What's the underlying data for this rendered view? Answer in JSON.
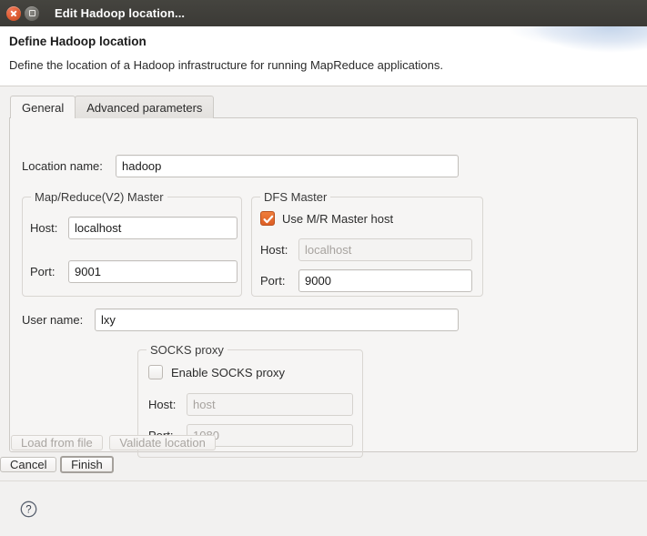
{
  "window": {
    "title": "Edit Hadoop location...",
    "close_icon": "close-icon",
    "maximize_icon": "maximize-icon"
  },
  "header": {
    "title": "Define Hadoop location",
    "subtitle": "Define the location of a Hadoop infrastructure for running MapReduce applications."
  },
  "tabs": [
    {
      "label": "General",
      "active": true
    },
    {
      "label": "Advanced parameters",
      "active": false
    }
  ],
  "form": {
    "location_name": {
      "label": "Location name:",
      "value": "hadoop",
      "placeholder": ""
    },
    "mr_master": {
      "legend": "Map/Reduce(V2) Master",
      "host": {
        "label": "Host:",
        "value": "localhost"
      },
      "port": {
        "label": "Port:",
        "value": "9001"
      }
    },
    "dfs_master": {
      "legend": "DFS Master",
      "use_mr_host": {
        "label": "Use M/R Master host",
        "checked": true
      },
      "host": {
        "label": "Host:",
        "value": "localhost",
        "disabled": true
      },
      "port": {
        "label": "Port:",
        "value": "9000",
        "disabled": false
      }
    },
    "user_name": {
      "label": "User name:",
      "value": "lxy"
    },
    "socks_proxy": {
      "legend": "SOCKS proxy",
      "enable": {
        "label": "Enable SOCKS proxy",
        "checked": false
      },
      "host": {
        "label": "Host:",
        "value": "host",
        "disabled": true
      },
      "port": {
        "label": "Port:",
        "value": "1080",
        "disabled": true
      }
    },
    "actions": {
      "load_from_file": "Load from file",
      "validate_location": "Validate location"
    }
  },
  "footer": {
    "help_icon": "help-icon",
    "cancel": "Cancel",
    "finish": "Finish"
  },
  "colors": {
    "titlebar": "#3b3a36",
    "accent_checkbox": "#dd5f25",
    "panel": "#f6f5f4",
    "dialog_bg": "#f2f1f0"
  }
}
